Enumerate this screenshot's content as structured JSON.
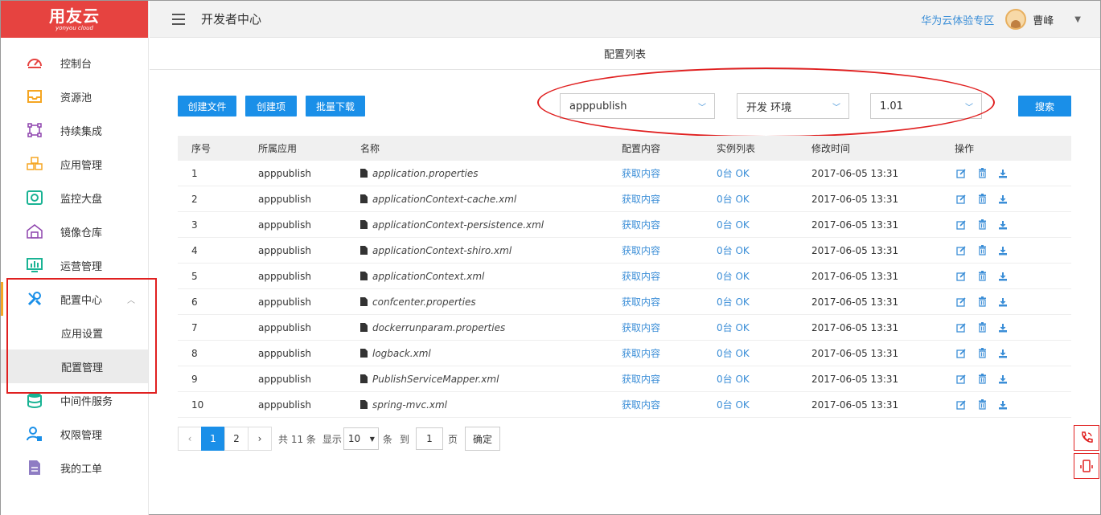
{
  "app": {
    "logo_main": "用友云",
    "logo_sub": "yonyou cloud"
  },
  "header": {
    "title": "开发者中心",
    "zone_link": "华为云体验专区",
    "username": "曹峰"
  },
  "sidebar": {
    "items": [
      {
        "label": "控制台",
        "icon": "dashboard-gauge-icon"
      },
      {
        "label": "资源池",
        "icon": "inbox-icon"
      },
      {
        "label": "持续集成",
        "icon": "integration-icon"
      },
      {
        "label": "应用管理",
        "icon": "boxes-icon"
      },
      {
        "label": "监控大盘",
        "icon": "monitor-icon"
      },
      {
        "label": "镜像仓库",
        "icon": "warehouse-icon"
      },
      {
        "label": "运营管理",
        "icon": "chart-screen-icon"
      },
      {
        "label": "配置中心",
        "icon": "tools-icon"
      },
      {
        "label": "中间件服务",
        "icon": "database-icon"
      },
      {
        "label": "权限管理",
        "icon": "user-lock-icon"
      },
      {
        "label": "我的工单",
        "icon": "document-icon"
      }
    ],
    "subitems": [
      {
        "label": "应用设置"
      },
      {
        "label": "配置管理"
      }
    ]
  },
  "page": {
    "subtitle": "配置列表"
  },
  "toolbar": {
    "create_file": "创建文件",
    "create_item": "创建项",
    "batch_download": "批量下载",
    "app_select": "apppublish",
    "env_select": "开发 环境",
    "version_select": "1.01",
    "search": "搜索"
  },
  "table": {
    "headers": {
      "no": "序号",
      "app": "所属应用",
      "name": "名称",
      "config": "配置内容",
      "instances": "实例列表",
      "modified": "修改时间",
      "ops": "操作"
    },
    "rows": [
      {
        "no": "1",
        "app": "apppublish",
        "name": "application.properties",
        "config": "获取内容",
        "instances": "0台 OK",
        "modified": "2017-06-05 13:31"
      },
      {
        "no": "2",
        "app": "apppublish",
        "name": "applicationContext-cache.xml",
        "config": "获取内容",
        "instances": "0台 OK",
        "modified": "2017-06-05 13:31"
      },
      {
        "no": "3",
        "app": "apppublish",
        "name": "applicationContext-persistence.xml",
        "config": "获取内容",
        "instances": "0台 OK",
        "modified": "2017-06-05 13:31"
      },
      {
        "no": "4",
        "app": "apppublish",
        "name": "applicationContext-shiro.xml",
        "config": "获取内容",
        "instances": "0台 OK",
        "modified": "2017-06-05 13:31"
      },
      {
        "no": "5",
        "app": "apppublish",
        "name": "applicationContext.xml",
        "config": "获取内容",
        "instances": "0台 OK",
        "modified": "2017-06-05 13:31"
      },
      {
        "no": "6",
        "app": "apppublish",
        "name": "confcenter.properties",
        "config": "获取内容",
        "instances": "0台 OK",
        "modified": "2017-06-05 13:31"
      },
      {
        "no": "7",
        "app": "apppublish",
        "name": "dockerrunparam.properties",
        "config": "获取内容",
        "instances": "0台 OK",
        "modified": "2017-06-05 13:31"
      },
      {
        "no": "8",
        "app": "apppublish",
        "name": "logback.xml",
        "config": "获取内容",
        "instances": "0台 OK",
        "modified": "2017-06-05 13:31"
      },
      {
        "no": "9",
        "app": "apppublish",
        "name": "PublishServiceMapper.xml",
        "config": "获取内容",
        "instances": "0台 OK",
        "modified": "2017-06-05 13:31"
      },
      {
        "no": "10",
        "app": "apppublish",
        "name": "spring-mvc.xml",
        "config": "获取内容",
        "instances": "0台 OK",
        "modified": "2017-06-05 13:31"
      }
    ]
  },
  "pagination": {
    "prev": "‹",
    "next": "›",
    "pages": [
      "1",
      "2"
    ],
    "total_text": "共 11 条",
    "show_label": "显示",
    "page_size": "10",
    "items_label": "条",
    "goto_label": "到",
    "goto_value": "1",
    "page_label": "页",
    "confirm": "确定"
  },
  "colors": {
    "brand_red": "#e64340",
    "primary_blue": "#1a8fe8",
    "link_blue": "#3b8ed7",
    "annotation_red": "#e02020"
  }
}
